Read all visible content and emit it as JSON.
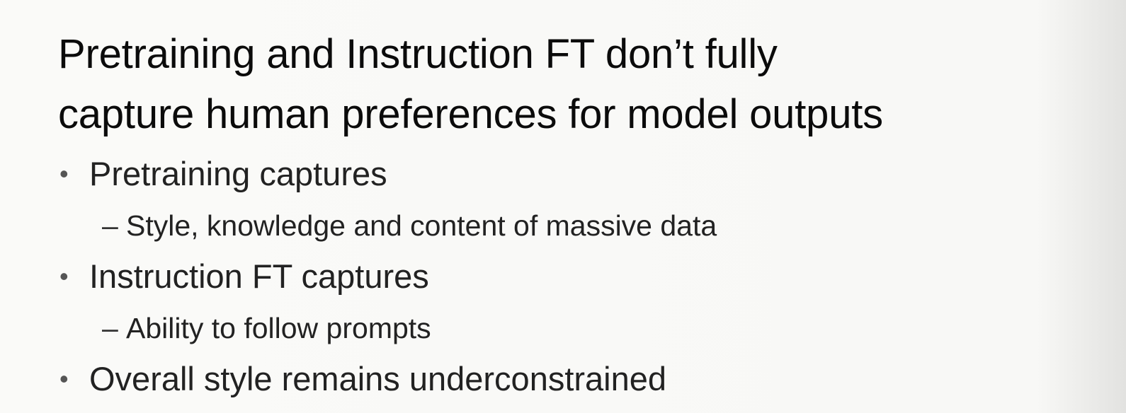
{
  "slide": {
    "title_lines": [
      "Pretraining and Instruction FT don’t fully",
      "capture human preferences for model outputs"
    ],
    "bullet_marker": "•",
    "sub_marker": "–",
    "bullets": [
      {
        "text": "Pretraining captures",
        "sub": "Style, knowledge and content of massive data"
      },
      {
        "text": "Instruction FT captures",
        "sub": "Ability to follow prompts"
      },
      {
        "text": "Overall style remains underconstrained",
        "sub": null
      }
    ]
  }
}
